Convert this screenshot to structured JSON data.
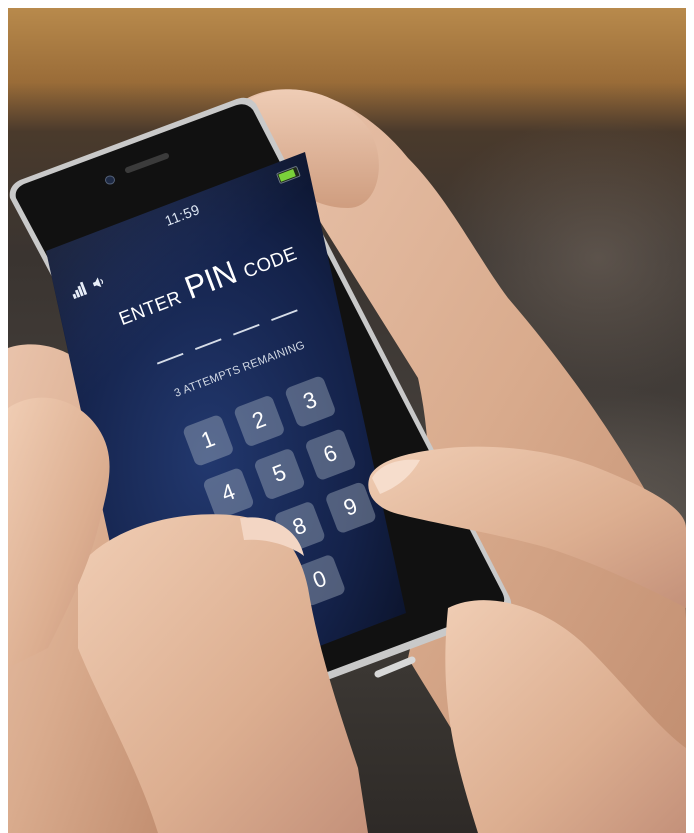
{
  "status_bar": {
    "time": "11:59",
    "icons": [
      "signal-icon",
      "speaker-icon",
      "battery-icon"
    ],
    "battery_color": "#7ad13a"
  },
  "pin_screen": {
    "title_prefix": "ENTER",
    "title_main": "PIN",
    "title_suffix": "CODE",
    "pin_slots": 4,
    "attempts_text": "3 ATTEMPTS REMAINING",
    "keys": [
      "1",
      "2",
      "3",
      "4",
      "5",
      "6",
      "8",
      "9",
      "0"
    ]
  },
  "colors": {
    "screen_top": "#0b1530",
    "screen_mid": "#1f3466",
    "phone_frame": "#1a1a1a",
    "phone_edge": "#c9c9c9"
  }
}
